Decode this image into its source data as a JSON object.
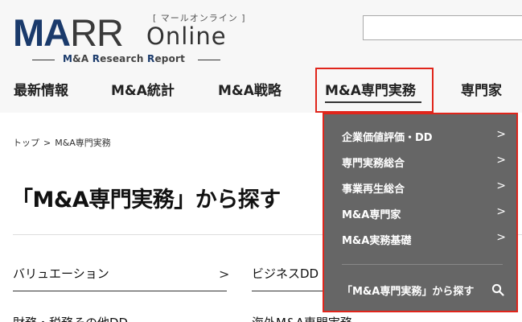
{
  "logo": {
    "brand_ma": "MA",
    "brand_rr": "RR",
    "kana": "[ マールオンライン ]",
    "online": "Online",
    "tagline_1": "M",
    "tagline_2": "&A ",
    "tagline_3": "R",
    "tagline_4": "esearch ",
    "tagline_5": "R",
    "tagline_6": "eport"
  },
  "search": {
    "placeholder": ""
  },
  "nav": {
    "items": [
      {
        "label": "最新情報"
      },
      {
        "label": "M&A統計"
      },
      {
        "label": "M&A戦略"
      },
      {
        "label": "M&A専門実務"
      },
      {
        "label": "専門家"
      }
    ],
    "active_index": 3
  },
  "breadcrumb": {
    "home": "トップ",
    "separator": ">",
    "current": "M&A専門実務"
  },
  "page_title": "「M&A専門実務」から探す",
  "grid": {
    "items": [
      {
        "label": "バリュエーション"
      },
      {
        "label": "ビジネスDD"
      },
      {
        "label": "財務・税務その他DD"
      },
      {
        "label": "海外M&A専門実務"
      }
    ],
    "chevron": ">"
  },
  "dropdown": {
    "items": [
      {
        "label": "企業価値評価・DD"
      },
      {
        "label": "専門実務総合"
      },
      {
        "label": "事業再生総合"
      },
      {
        "label": "M&A専門家"
      },
      {
        "label": "M&A実務基礎"
      }
    ],
    "chevron": ">",
    "search_label": "「M&A専門実務」から探す"
  },
  "colors": {
    "brand_navy": "#1a3a6b",
    "highlight_red": "#e0251b",
    "dropdown_bg": "#666666"
  },
  "icons": {
    "dropdown_search": "search-icon",
    "chevron": "chevron-right-icon"
  }
}
